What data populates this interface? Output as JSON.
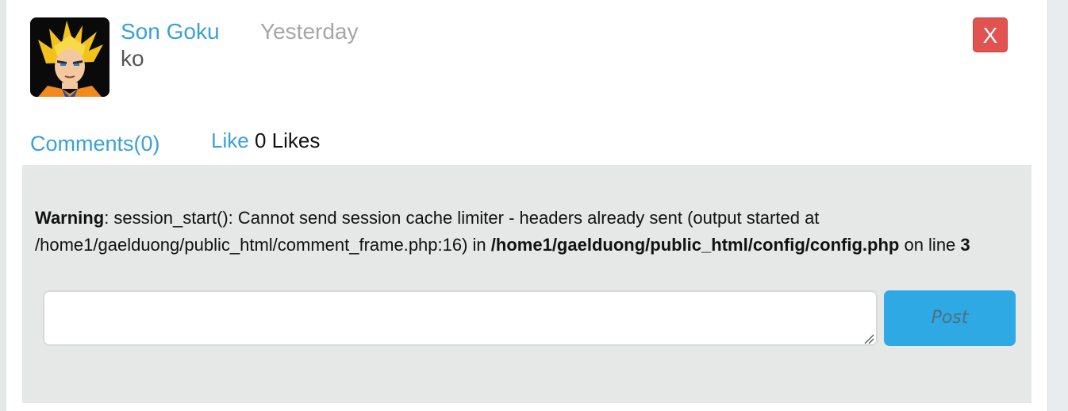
{
  "post": {
    "author": "Son Goku",
    "time": "Yesterday",
    "text": "ko",
    "close_label": "X"
  },
  "actions": {
    "comments_label": "Comments(0)",
    "like_label": "Like",
    "likes_count": "0",
    "likes_suffix": "Likes"
  },
  "warning": {
    "label": "Warning",
    "message": ": session_start(): Cannot send session cache limiter - headers already sent (output started at /home1/gaelduong/public_html/comment_frame.php:16) in ",
    "file": "/home1/gaelduong/public_html/config/config.php",
    "on_line": " on line ",
    "line": "3"
  },
  "comment_form": {
    "value": "",
    "post_label": "Post"
  },
  "icons": {
    "avatar": "profile-picture",
    "close": "close-icon",
    "resize": "resize-grip-icon"
  },
  "colors": {
    "link": "#3aa0d8",
    "close_button": "#e05350",
    "post_button": "#2fa9e3",
    "frame_background": "#e5e8e7"
  }
}
